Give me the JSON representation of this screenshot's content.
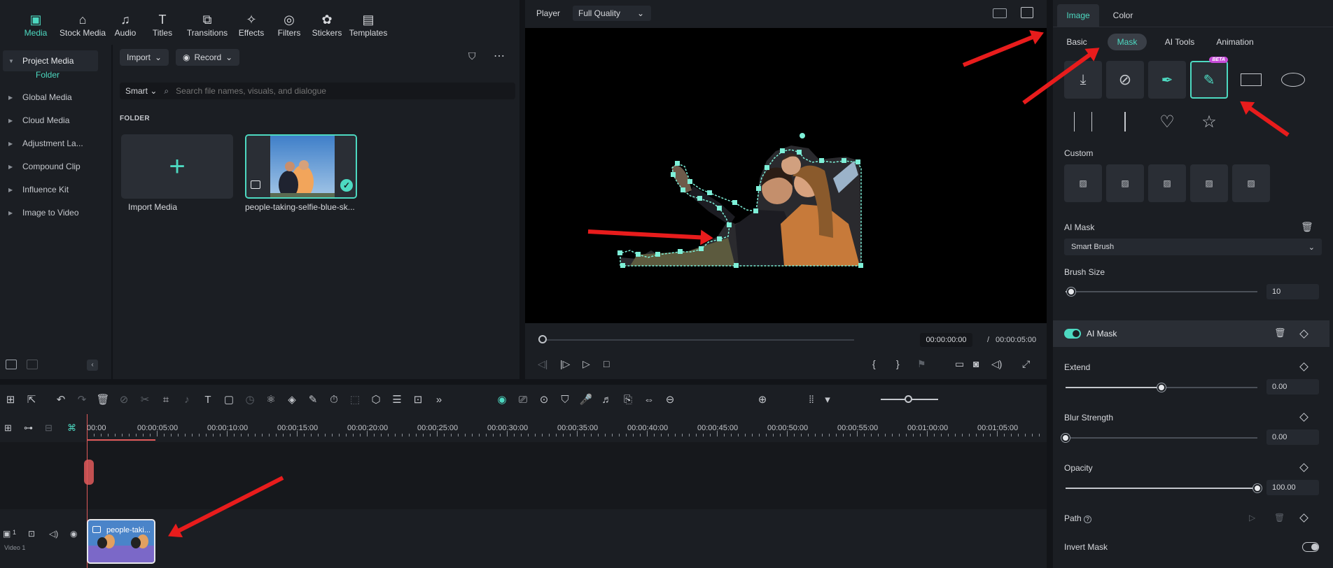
{
  "toolbar": {
    "tabs": [
      {
        "label": "Media",
        "icon": "media-icon",
        "active": true
      },
      {
        "label": "Stock Media",
        "icon": "stock-media-icon"
      },
      {
        "label": "Audio",
        "icon": "audio-icon"
      },
      {
        "label": "Titles",
        "icon": "titles-icon"
      },
      {
        "label": "Transitions",
        "icon": "transitions-icon"
      },
      {
        "label": "Effects",
        "icon": "effects-icon"
      },
      {
        "label": "Filters",
        "icon": "filters-icon"
      },
      {
        "label": "Stickers",
        "icon": "stickers-icon"
      },
      {
        "label": "Templates",
        "icon": "templates-icon"
      }
    ]
  },
  "sidebar": {
    "project_media": "Project Media",
    "folder": "Folder",
    "items": [
      "Global Media",
      "Cloud Media",
      "Adjustment La...",
      "Compound Clip",
      "Influence Kit",
      "Image to Video"
    ]
  },
  "media": {
    "import_label": "Import",
    "record_label": "Record",
    "smart_label": "Smart",
    "search_placeholder": "Search file names, visuals, and dialogue",
    "folder_heading": "FOLDER",
    "import_media_label": "Import Media",
    "clip_label": "people-taking-selfie-blue-sk..."
  },
  "player": {
    "label": "Player",
    "quality": "Full Quality",
    "current_time": "00:00:00:00",
    "separator": "/",
    "total_time": "00:00:05:00"
  },
  "right_panel": {
    "tabs": [
      "Image",
      "Color"
    ],
    "subtabs": [
      "Basic",
      "Mask",
      "AI Tools",
      "Animation"
    ],
    "beta": "BETA",
    "custom_label": "Custom",
    "ai_mask_label": "AI Mask",
    "brush_type": "Smart Brush",
    "brush_size_label": "Brush Size",
    "brush_size_value": "10",
    "ai_mask_toggle_label": "AI Mask",
    "extend_label": "Extend",
    "extend_value": "0.00",
    "blur_label": "Blur Strength",
    "blur_value": "0.00",
    "opacity_label": "Opacity",
    "opacity_value": "100.00",
    "path_label": "Path",
    "invert_label": "Invert Mask",
    "levels": {
      "brush_size": 0.03,
      "extend": 0.5,
      "blur": 0.0,
      "opacity": 1.0
    }
  },
  "timeline": {
    "ticks": [
      "00:00",
      "00:00:05:00",
      "00:00:10:00",
      "00:00:15:00",
      "00:00:20:00",
      "00:00:25:00",
      "00:00:30:00",
      "00:00:35:00",
      "00:00:40:00",
      "00:00:45:00",
      "00:00:50:00",
      "00:00:55:00",
      "00:01:00:00",
      "00:01:05:00"
    ],
    "clip_name": "people-taki...",
    "track_number": "1",
    "track_label": "Video 1"
  },
  "colors": {
    "accent": "#4dd9c1",
    "annotation_arrow": "#e81c1c",
    "playhead": "#e05a5a",
    "clip": "#7b68c8"
  }
}
